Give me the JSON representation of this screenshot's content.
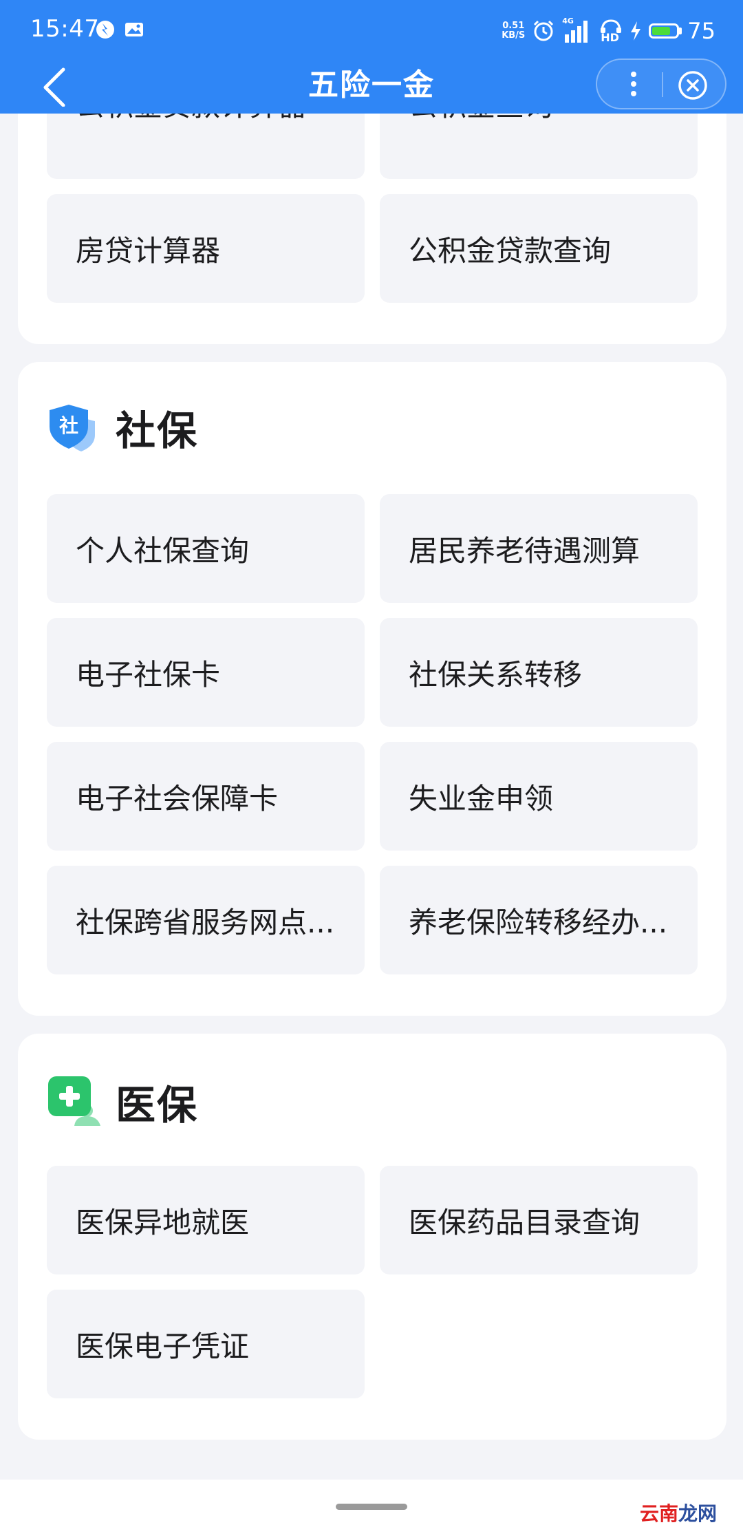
{
  "status_bar": {
    "time": "15:47",
    "net_speed_value": "0.51",
    "net_speed_unit": "KB/S",
    "network": "4G",
    "hd": "HD",
    "battery": "75",
    "battery_level_percent": 75
  },
  "nav": {
    "title": "五险一金"
  },
  "fund_section": {
    "tiles": [
      "公积金贷款计算器",
      "公积金查询",
      "房贷计算器",
      "公积金贷款查询"
    ]
  },
  "social_section": {
    "title": "社保",
    "icon_glyph": "社",
    "tiles": [
      "个人社保查询",
      "居民养老待遇测算",
      "电子社保卡",
      "社保关系转移",
      "电子社会保障卡",
      "失业金申领",
      "社保跨省服务网点...",
      "养老保险转移经办..."
    ]
  },
  "medical_section": {
    "title": "医保",
    "tiles": [
      "医保异地就医",
      "医保药品目录查询",
      "医保电子凭证"
    ]
  },
  "watermark": {
    "part1": "云南",
    "part2": "龙网"
  },
  "colors": {
    "header_blue": "#2f86f6",
    "social_icon_blue": "#2d8cf0",
    "medical_icon_green": "#2cc46c",
    "page_bg": "#f3f4f8"
  }
}
